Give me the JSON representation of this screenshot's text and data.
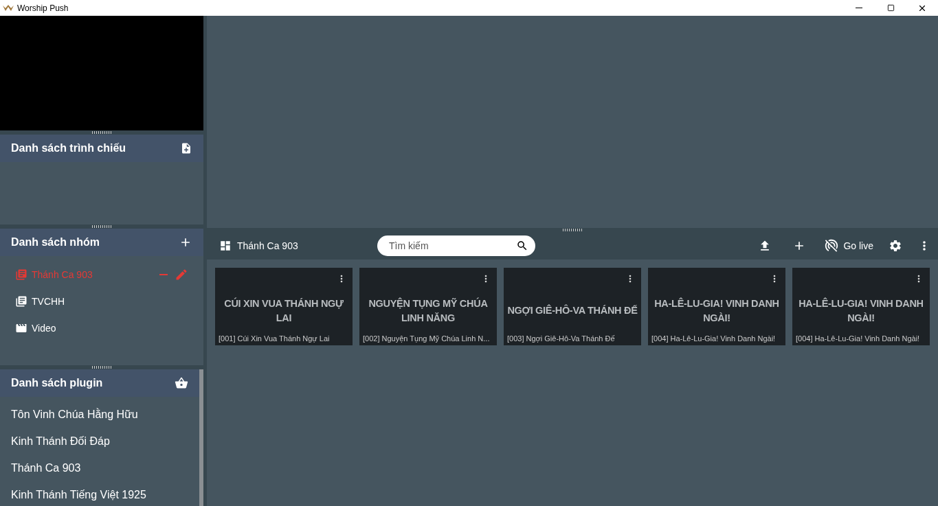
{
  "window": {
    "title": "Worship Push"
  },
  "presentation_list": {
    "title": "Danh sách trình chiếu"
  },
  "groups": {
    "title": "Danh sách nhóm",
    "items": [
      {
        "label": "Thánh Ca 903",
        "kind": "book",
        "selected": true
      },
      {
        "label": "TVCHH",
        "kind": "book",
        "selected": false
      },
      {
        "label": "Video",
        "kind": "video",
        "selected": false
      }
    ]
  },
  "plugins": {
    "title": "Danh sách plugin",
    "items": [
      "Tôn Vinh Chúa Hằng Hữu",
      "Kinh Thánh Đối Đáp",
      "Thánh Ca 903",
      "Kinh Thánh Tiếng Việt 1925"
    ]
  },
  "toolbar": {
    "title": "Thánh Ca 903",
    "search": {
      "placeholder": "Tìm kiếm"
    },
    "go_live": "Go live"
  },
  "songs": [
    {
      "heading": "CÚI XIN VUA THÁNH NGỰ LAI",
      "caption": "[001] Cúi Xin Vua Thánh Ngự Lai"
    },
    {
      "heading": "NGUYỆN TỤNG MỸ CHÚA LINH NĂNG",
      "caption": "[002] Nguyện Tụng Mỹ Chúa Linh N..."
    },
    {
      "heading": "NGỢI GIÊ-HÔ-VA THÁNH ĐẾ",
      "caption": "[003] Ngợi Giê-Hô-Va Thánh Đế"
    },
    {
      "heading": "HA-LÊ-LU-GIA! VINH DANH NGÀI!",
      "caption": "[004] Ha-Lê-Lu-Gia! Vinh Danh Ngài!"
    },
    {
      "heading": "HA-LÊ-LU-GIA! VINH DANH NGÀI!",
      "caption": "[004] Ha-Lê-Lu-Gia! Vinh Danh Ngài!"
    }
  ]
}
